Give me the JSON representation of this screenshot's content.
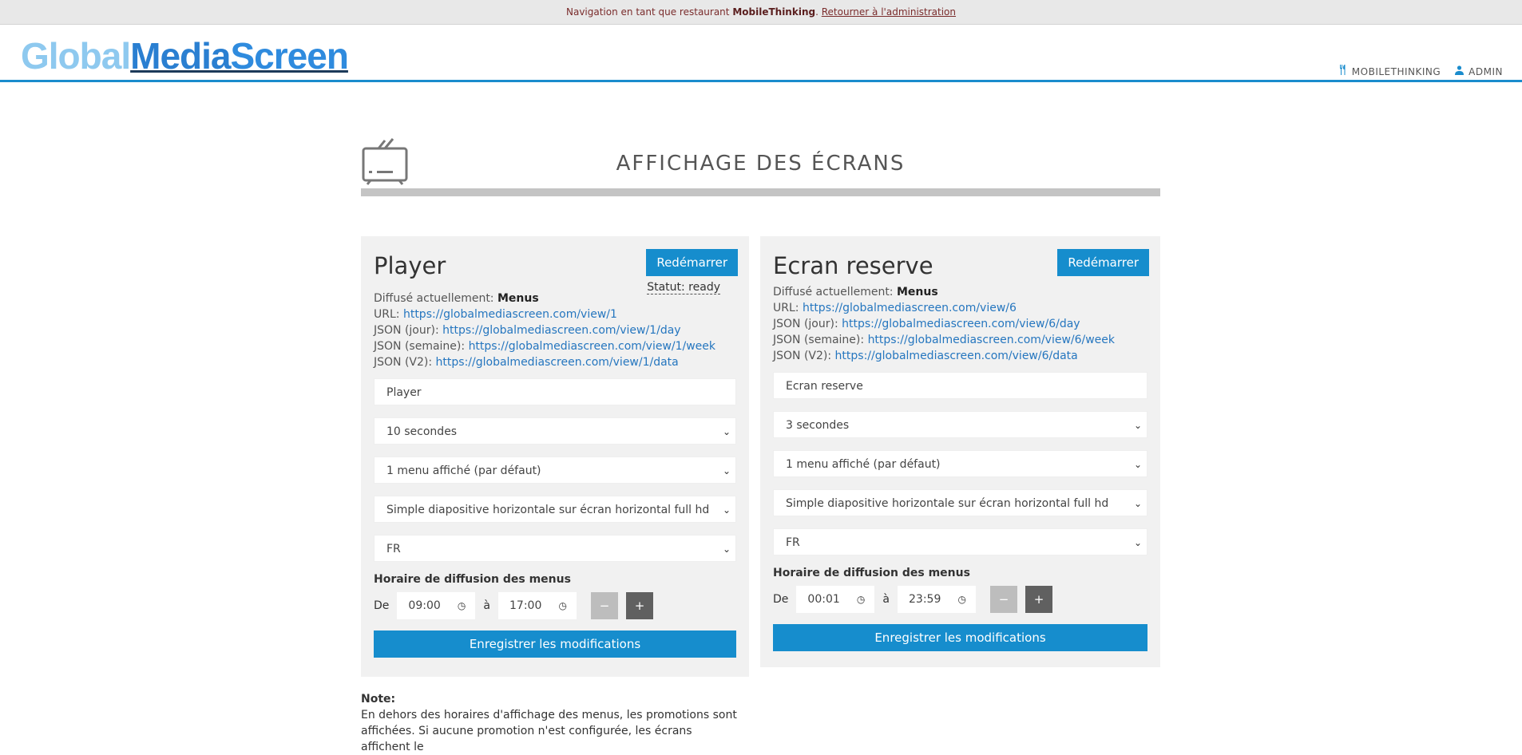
{
  "topbar": {
    "prefix": "Navigation en tant que restaurant",
    "restaurant": "MobileThinking",
    "sep": ".",
    "back_link": "Retourner à l'administration"
  },
  "logo": {
    "part1": "Global",
    "part2": "Media",
    "part3": "Screen"
  },
  "usernav": {
    "restaurant": "MOBILETHINKING",
    "user": "ADMIN"
  },
  "page": {
    "title": "AFFICHAGE DES ÉCRANS"
  },
  "labels": {
    "restart": "Redémarrer",
    "diffuse": "Diffusé actuellement:",
    "url": "URL:",
    "json_day": "JSON (jour):",
    "json_week": "JSON (semaine):",
    "json_v2": "JSON (V2):",
    "schedule": "Horaire de diffusion des menus",
    "from": "De",
    "to": "à",
    "minus": "−",
    "plus": "+",
    "save": "Enregistrer les modifications"
  },
  "screens": [
    {
      "name": "Player",
      "status": "Statut: ready",
      "current": "Menus",
      "url": "https://globalmediascreen.com/view/1",
      "json_day": "https://globalmediascreen.com/view/1/day",
      "json_week": "https://globalmediascreen.com/view/1/week",
      "json_v2": "https://globalmediascreen.com/view/1/data",
      "name_value": "Player",
      "duration": "10 secondes",
      "menus_count": "1 menu affiché (par défaut)",
      "layout": "Simple diapositive horizontale sur écran horizontal full hd",
      "language": "FR",
      "from": "09:00",
      "to": "17:00"
    },
    {
      "name": "Ecran reserve",
      "current": "Menus",
      "url": "https://globalmediascreen.com/view/6",
      "json_day": "https://globalmediascreen.com/view/6/day",
      "json_week": "https://globalmediascreen.com/view/6/week",
      "json_v2": "https://globalmediascreen.com/view/6/data",
      "name_value": "Ecran reserve",
      "duration": "3 secondes",
      "menus_count": "1 menu affiché (par défaut)",
      "layout": "Simple diapositive horizontale sur écran horizontal full hd",
      "language": "FR",
      "from": "00:01",
      "to": "23:59"
    }
  ],
  "note": {
    "title": "Note:",
    "line1": "En dehors des horaires d'affichage des menus, les promotions sont",
    "line2": "affichées. Si aucune promotion n'est configurée, les écrans affichent le"
  }
}
